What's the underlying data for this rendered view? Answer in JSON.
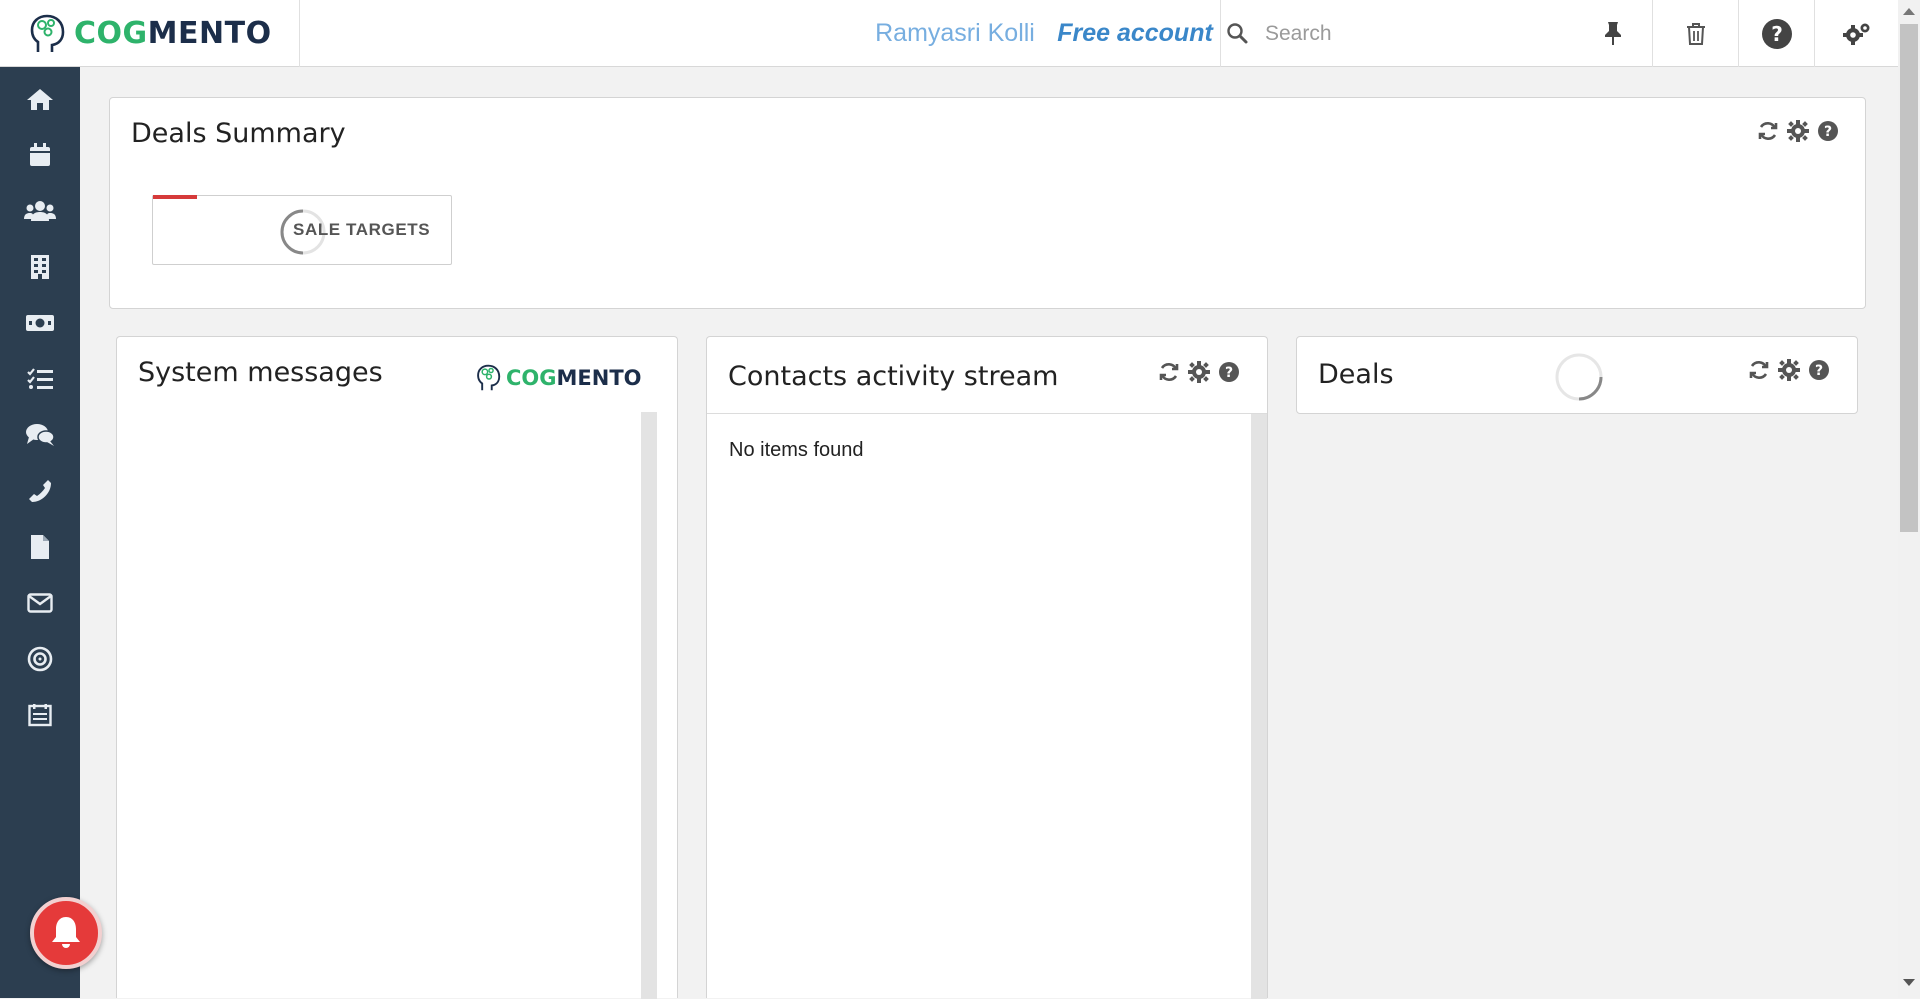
{
  "brand": {
    "logo_cog": "COG",
    "logo_mento": "MENTO",
    "cog_color": "#2eb36b",
    "mento_color": "#1c2e4a"
  },
  "header": {
    "user_name": "Ramyasri Kolli",
    "account_type": "Free account",
    "search_placeholder": "Search",
    "icons": [
      "search-icon",
      "pin-icon",
      "trash-icon",
      "help-icon",
      "settings-icon"
    ]
  },
  "sidebar": {
    "background": "#2c3e50",
    "items": [
      {
        "icon": "home-icon"
      },
      {
        "icon": "calendar-icon"
      },
      {
        "icon": "contacts-icon"
      },
      {
        "icon": "companies-icon"
      },
      {
        "icon": "deals-icon"
      },
      {
        "icon": "tasks-icon"
      },
      {
        "icon": "cases-icon"
      },
      {
        "icon": "calls-icon"
      },
      {
        "icon": "documents-icon"
      },
      {
        "icon": "email-icon"
      },
      {
        "icon": "campaigns-icon"
      },
      {
        "icon": "forms-icon"
      }
    ]
  },
  "deals_summary": {
    "title": "Deals Summary",
    "sale_targets_label": "SALE TARGETS",
    "accent_color": "#d63a3a",
    "tools": [
      "refresh-icon",
      "gear-icon",
      "help-icon"
    ]
  },
  "system_messages": {
    "title": "System messages",
    "logo_cog": "COG",
    "logo_mento": "MENTO"
  },
  "contacts_stream": {
    "title": "Contacts activity stream",
    "empty_text": "No items found",
    "tools": [
      "refresh-icon",
      "gear-icon",
      "help-icon"
    ]
  },
  "deals": {
    "title": "Deals",
    "tools": [
      "refresh-icon",
      "gear-icon",
      "help-icon"
    ]
  },
  "notification": {
    "icon": "bell-icon",
    "color": "#e53a3a"
  }
}
